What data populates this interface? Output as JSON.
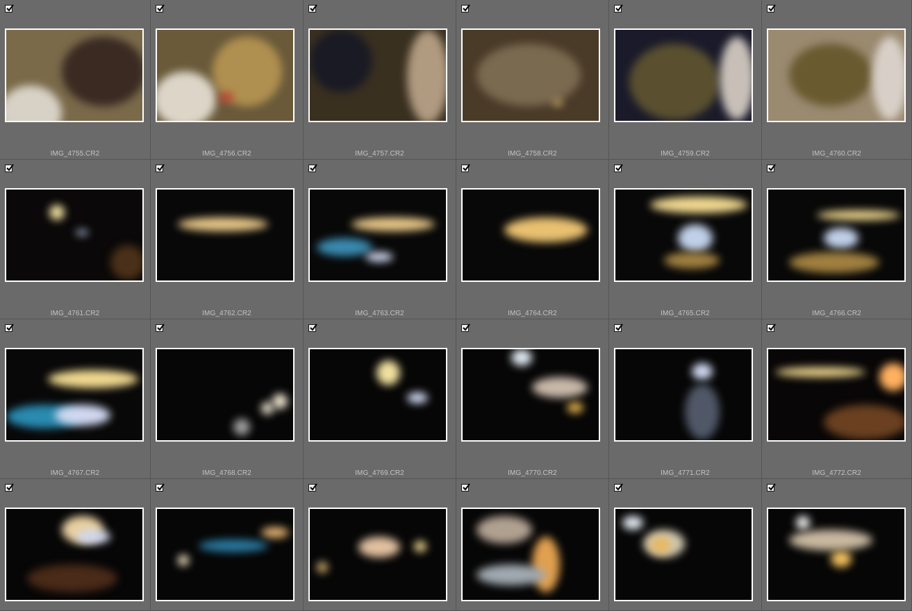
{
  "grid": {
    "columns": 6,
    "items": [
      {
        "filename": "IMG_4755.CR2",
        "checked": true,
        "tone": "warm"
      },
      {
        "filename": "IMG_4756.CR2",
        "checked": true,
        "tone": "warm"
      },
      {
        "filename": "IMG_4757.CR2",
        "checked": true,
        "tone": "warm"
      },
      {
        "filename": "IMG_4758.CR2",
        "checked": true,
        "tone": "warm"
      },
      {
        "filename": "IMG_4759.CR2",
        "checked": true,
        "tone": "warm"
      },
      {
        "filename": "IMG_4760.CR2",
        "checked": true,
        "tone": "warm"
      },
      {
        "filename": "IMG_4761.CR2",
        "checked": true,
        "tone": "dark"
      },
      {
        "filename": "IMG_4762.CR2",
        "checked": true,
        "tone": "dark"
      },
      {
        "filename": "IMG_4763.CR2",
        "checked": true,
        "tone": "dark"
      },
      {
        "filename": "IMG_4764.CR2",
        "checked": true,
        "tone": "dark"
      },
      {
        "filename": "IMG_4765.CR2",
        "checked": true,
        "tone": "dark"
      },
      {
        "filename": "IMG_4766.CR2",
        "checked": true,
        "tone": "dark"
      },
      {
        "filename": "IMG_4767.CR2",
        "checked": true,
        "tone": "dark"
      },
      {
        "filename": "IMG_4768.CR2",
        "checked": true,
        "tone": "dark"
      },
      {
        "filename": "IMG_4769.CR2",
        "checked": true,
        "tone": "dark"
      },
      {
        "filename": "IMG_4770.CR2",
        "checked": true,
        "tone": "dark"
      },
      {
        "filename": "IMG_4771.CR2",
        "checked": true,
        "tone": "dark"
      },
      {
        "filename": "IMG_4772.CR2",
        "checked": true,
        "tone": "dark"
      },
      {
        "filename": "",
        "checked": true,
        "tone": "dark"
      },
      {
        "filename": "",
        "checked": true,
        "tone": "dark"
      },
      {
        "filename": "",
        "checked": true,
        "tone": "dark"
      },
      {
        "filename": "",
        "checked": true,
        "tone": "dark"
      },
      {
        "filename": "",
        "checked": true,
        "tone": "dark"
      },
      {
        "filename": "",
        "checked": true,
        "tone": "dark"
      }
    ]
  },
  "colors": {
    "cell_bg": "#6a6a6a",
    "thumb_border": "#ffffff",
    "filename_text": "#c4c4c4"
  },
  "icons": {
    "checkbox": "checkbox-checked-icon"
  }
}
